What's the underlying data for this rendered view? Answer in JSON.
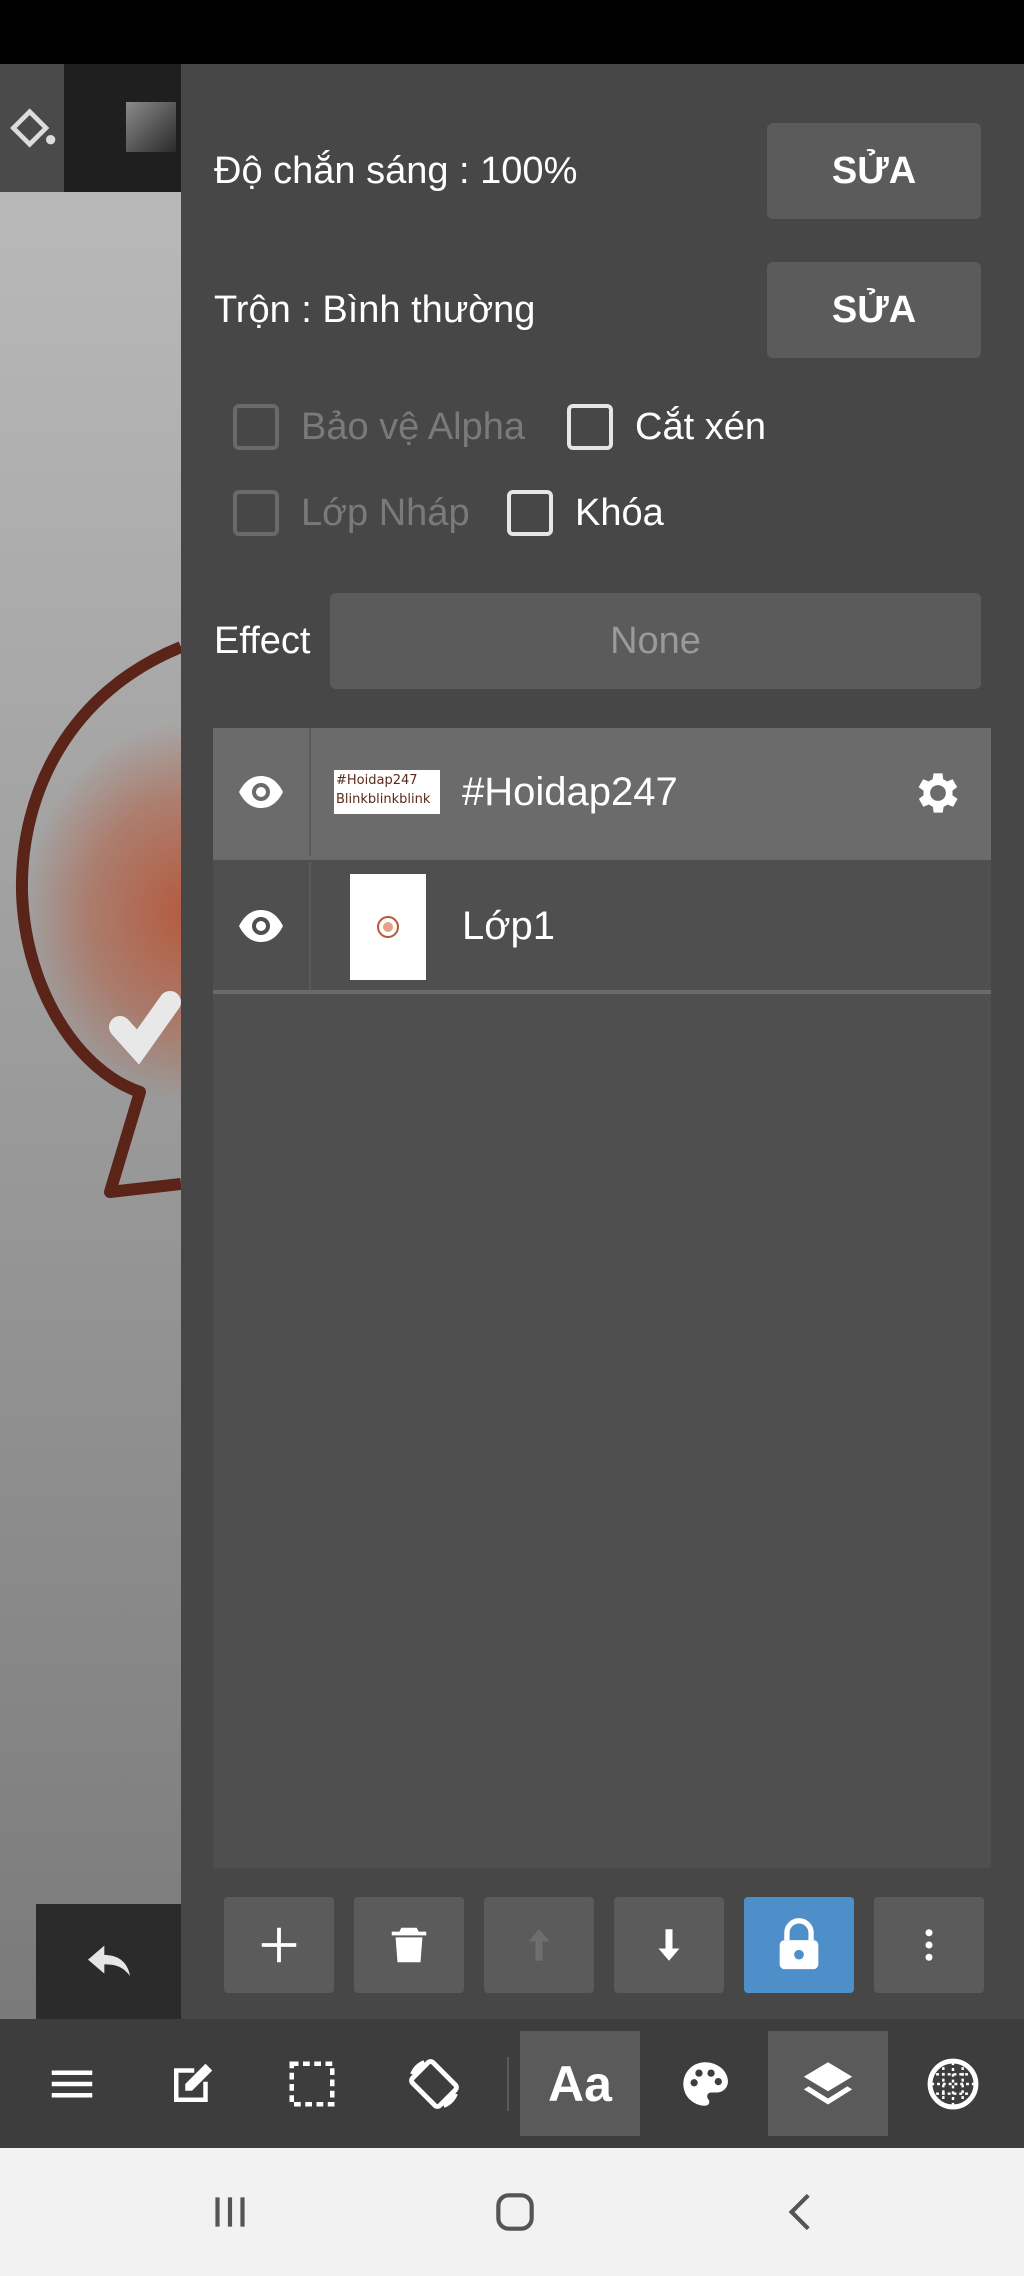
{
  "panel": {
    "opacity_label": "Độ chắn sáng : 100%",
    "opacity_edit": "SỬA",
    "blend_label": "Trộn : Bình thường",
    "blend_edit": "SỬA",
    "checks": {
      "alpha_protect": "Bảo vệ Alpha",
      "clipping": "Cắt xén",
      "draft_layer": "Lớp Nháp",
      "lock": "Khóa"
    },
    "effect_label": "Effect",
    "effect_value": "None"
  },
  "layers": [
    {
      "name": "#Hoidap247",
      "thumb_line1": "#Hoidap247",
      "thumb_line2": "Blinkblinkblink",
      "selected": true,
      "visible": true
    },
    {
      "name": "Lớp1",
      "selected": false,
      "visible": true
    }
  ],
  "action_bar": [
    "add-layer",
    "delete-layer",
    "move-up",
    "move-down",
    "lock",
    "more"
  ],
  "app_toolbar": {
    "text_tool_label": "Aa",
    "active_tool": "layers"
  },
  "colors": {
    "panel_bg": "#474747",
    "button_bg": "#5b5b5b",
    "selected_layer_bg": "#6b6b6b",
    "lock_active": "#4f8fc9",
    "app_toolbar_bg": "#3d3d3d",
    "artwork_stroke": "#6a2a1a",
    "artwork_glow": "#b5583a"
  }
}
